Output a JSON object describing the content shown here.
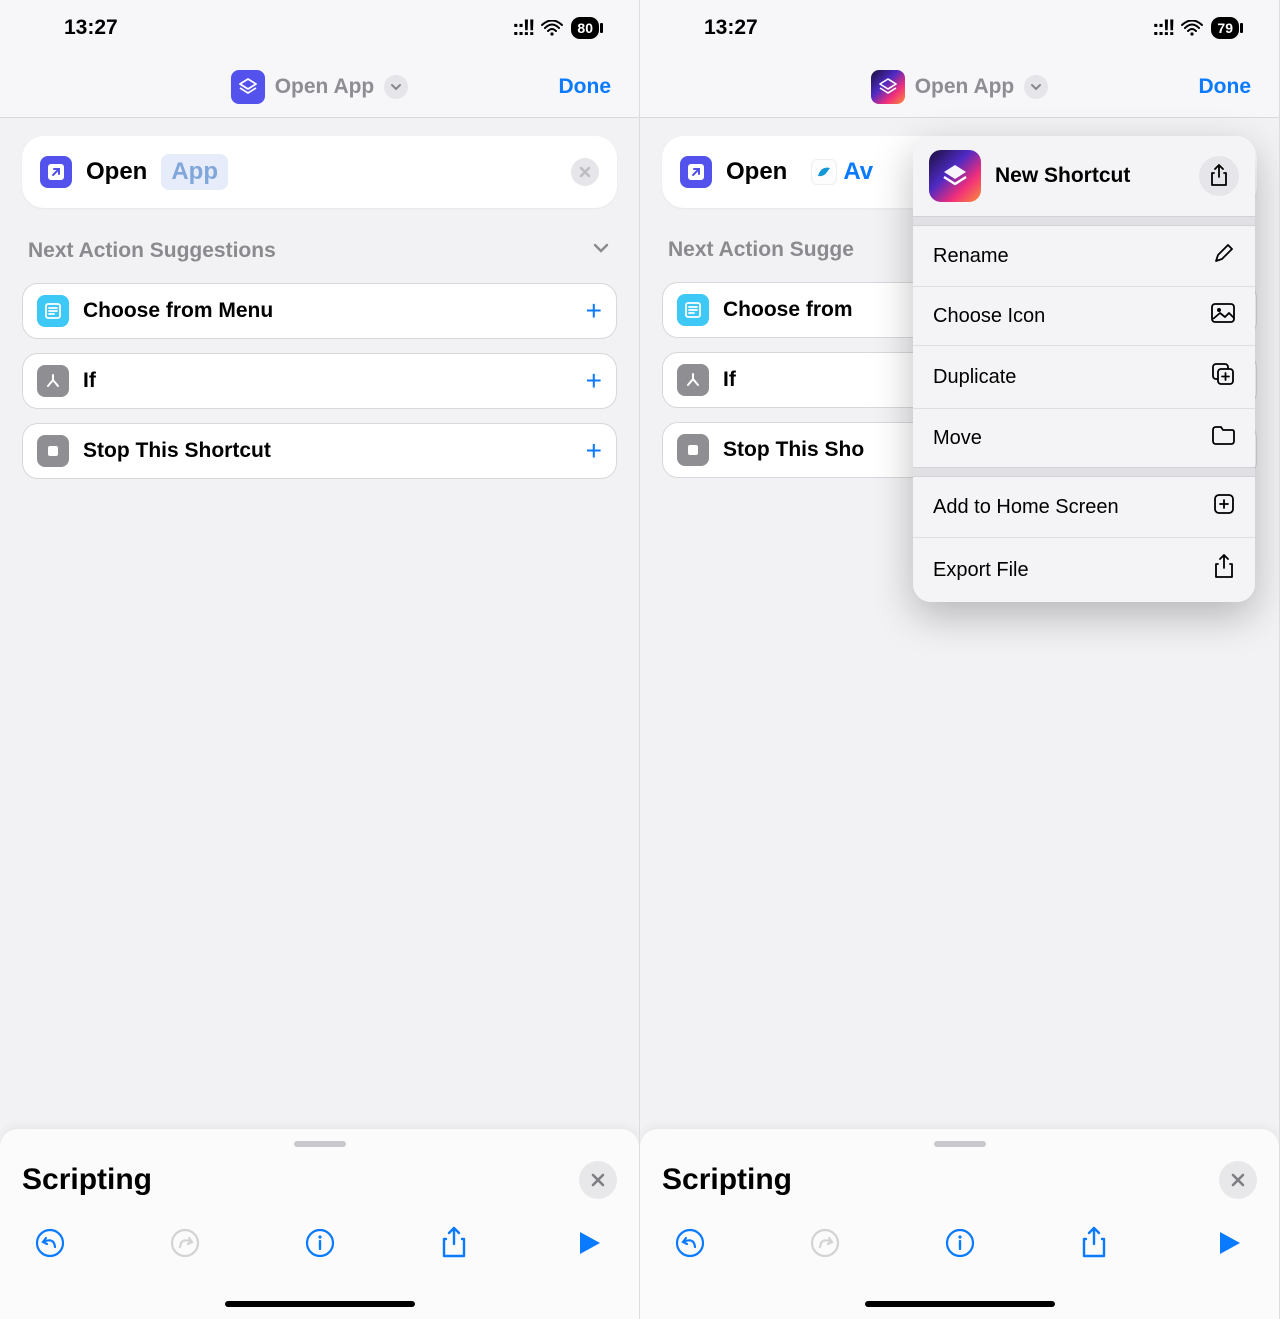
{
  "left": {
    "status": {
      "time": "13:27",
      "battery": "80"
    },
    "header": {
      "title": "Open App",
      "done": "Done"
    },
    "action": {
      "verb": "Open",
      "param": "App"
    },
    "section_title": "Next Action Suggestions",
    "suggestions": [
      {
        "label": "Choose from Menu"
      },
      {
        "label": "If"
      },
      {
        "label": "Stop This Shortcut"
      }
    ],
    "panel": {
      "title": "Scripting"
    }
  },
  "right": {
    "status": {
      "time": "13:27",
      "battery": "79"
    },
    "header": {
      "title": "Open App",
      "done": "Done"
    },
    "action": {
      "verb": "Open",
      "param": "Av"
    },
    "section_title": "Next Action Sugge",
    "suggestions": [
      {
        "label": "Choose from"
      },
      {
        "label": "If"
      },
      {
        "label": "Stop This Sho"
      }
    ],
    "panel": {
      "title": "Scripting"
    },
    "menu": {
      "name": "New Shortcut",
      "items": [
        {
          "label": "Rename",
          "icon": "pencil"
        },
        {
          "label": "Choose Icon",
          "icon": "picture"
        },
        {
          "label": "Duplicate",
          "icon": "duplicate"
        },
        {
          "label": "Move",
          "icon": "folder"
        }
      ],
      "items2": [
        {
          "label": "Add to Home Screen",
          "icon": "add-square"
        },
        {
          "label": "Export File",
          "icon": "export"
        }
      ]
    }
  }
}
